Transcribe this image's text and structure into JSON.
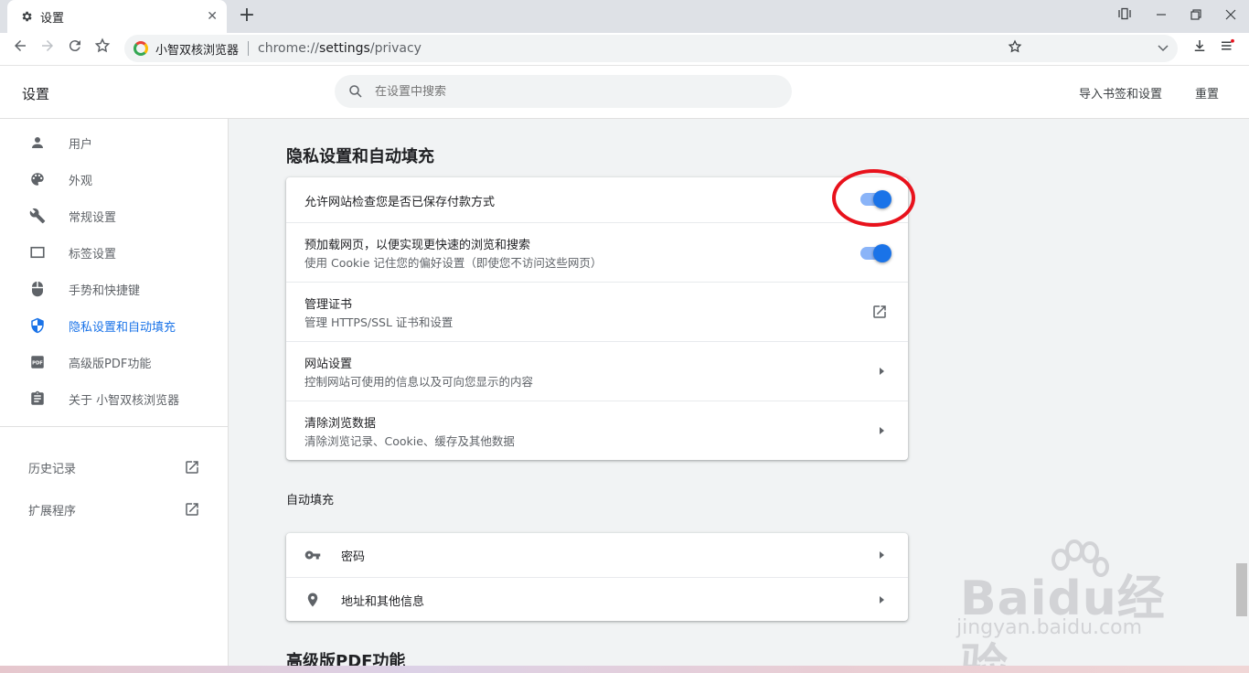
{
  "browser": {
    "tab": {
      "title": "设置"
    },
    "omnibox": {
      "brand": "小智双核浏览器",
      "url_scheme": "chrome://",
      "url_host": "settings",
      "url_path": "/privacy"
    }
  },
  "header": {
    "title": "设置",
    "search_placeholder": "在设置中搜索",
    "import_label": "导入书签和设置",
    "reset_label": "重置"
  },
  "sidebar": {
    "items": [
      {
        "label": "用户",
        "icon": "person-icon"
      },
      {
        "label": "外观",
        "icon": "palette-icon"
      },
      {
        "label": "常规设置",
        "icon": "wrench-icon"
      },
      {
        "label": "标签设置",
        "icon": "tab-icon"
      },
      {
        "label": "手势和快捷键",
        "icon": "mouse-icon"
      },
      {
        "label": "隐私设置和自动填充",
        "icon": "shield-icon",
        "active": true
      },
      {
        "label": "高级版PDF功能",
        "icon": "pdf-icon"
      },
      {
        "label": "关于 小智双核浏览器",
        "icon": "clipboard-icon"
      }
    ],
    "links": [
      {
        "label": "历史记录"
      },
      {
        "label": "扩展程序"
      }
    ]
  },
  "privacy": {
    "title": "隐私设置和自动填充",
    "rows": [
      {
        "label": "允许网站检查您是否已保存付款方式",
        "control": "toggle",
        "on": true
      },
      {
        "label": "预加载网页，以便实现更快速的浏览和搜索",
        "sub": "使用 Cookie 记住您的偏好设置（即使您不访问这些网页）",
        "control": "toggle",
        "on": true
      },
      {
        "label": "管理证书",
        "sub": "管理 HTTPS/SSL 证书和设置",
        "control": "external"
      },
      {
        "label": "网站设置",
        "sub": "控制网站可使用的信息以及可向您显示的内容",
        "control": "arrow"
      },
      {
        "label": "清除浏览数据",
        "sub": "清除浏览记录、Cookie、缓存及其他数据",
        "control": "arrow"
      }
    ]
  },
  "autofill": {
    "title": "自动填充",
    "rows": [
      {
        "label": "密码",
        "icon": "key-icon"
      },
      {
        "label": "地址和其他信息",
        "icon": "location-pin-icon"
      }
    ]
  },
  "pdf_section": {
    "title": "高级版PDF功能"
  },
  "watermark": {
    "main": "Baidu经验",
    "sub": "jingyan.baidu.com"
  },
  "colors": {
    "accent": "#1a73e8",
    "annotation": "#e8121c"
  }
}
